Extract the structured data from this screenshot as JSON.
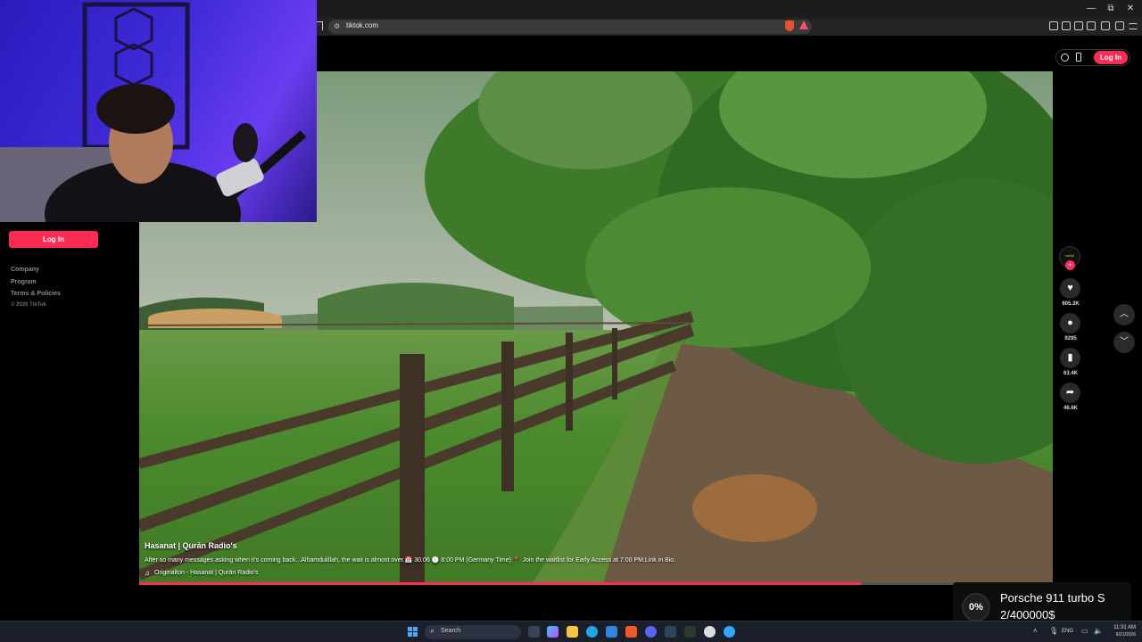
{
  "browser": {
    "url": "tiktok.com",
    "window_controls": {
      "minimize": "—",
      "restore": "⧉",
      "close": "✕"
    }
  },
  "tiktok": {
    "sidebar": {
      "login_label": "Log In",
      "footer_links": [
        "Company",
        "Program",
        "Terms & Policies"
      ],
      "copyright": "© 2026 TikTok"
    },
    "header": {
      "login_label": "Log In"
    },
    "video": {
      "author": "Hasanat | Qurān Radio's",
      "caption": "After so many messages asking when it's coming back...Alhamdulillah, the wait is almost over.📅 30.06 🕗 8:00 PM (Germany Time) 📍 Join the waitlist for Early Access at 7:00 PM.Link in Bio.",
      "music": "Originalton - Hasanat | Qurān Radio's",
      "progress": 0.79
    },
    "actions": {
      "avatar_text": "rabbit",
      "likes": "605.3K",
      "comments": "9295",
      "saves": "63.4K",
      "shares": "46.6K"
    }
  },
  "donation": {
    "percent": "0%",
    "title": "Porsche 911 turbo S",
    "goal": "2/400000$"
  },
  "taskbar": {
    "search_label": "Search",
    "language": "ENG",
    "time": "11:31 AM",
    "date": "6/21/2026"
  },
  "colors": {
    "accent": "#fe2c55",
    "taskbar": "#1b1f2a"
  }
}
